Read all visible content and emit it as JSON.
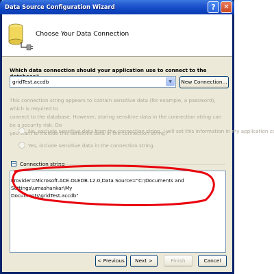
{
  "window": {
    "title": "Data Source Configuration Wizard",
    "help_glyph": "?",
    "close_glyph": "✕"
  },
  "header": {
    "title": "Choose Your Data Connection",
    "icon": "database-icon"
  },
  "connection": {
    "question": "Which data connection should your application use to connect to the database?",
    "selected": "gridTest.accdb",
    "new_connection_label": "New Connection..."
  },
  "sensitive": {
    "info_line1": "This connection string appears to contain sensitive data (for example, a password), which is required to",
    "info_line2": "connect to the database. However, storing sensitive data in the connection string can be a security risk. Do",
    "info_line3": "you want to include this sensitive data in the connection string?",
    "option_exclude": "No, exclude sensitive data from the connection string. I will set this information in my application code.",
    "option_include": "Yes, include sensitive data in the connection string."
  },
  "connection_string": {
    "label": "Connection string",
    "expander_glyph": "−",
    "line1": "Provider=Microsoft.ACE.OLEDB.12.0;Data Source=\"C:\\Documents and Settings\\umashankar\\My",
    "line2": "Documents\\gridTest.accdb\""
  },
  "footer": {
    "previous": "< Previous",
    "next": "Next >",
    "finish": "Finish",
    "cancel": "Cancel"
  },
  "colors": {
    "titlebar": "#0a3ab0",
    "annotation": "#e8000c",
    "dialog_bg": "#ece9d8"
  }
}
